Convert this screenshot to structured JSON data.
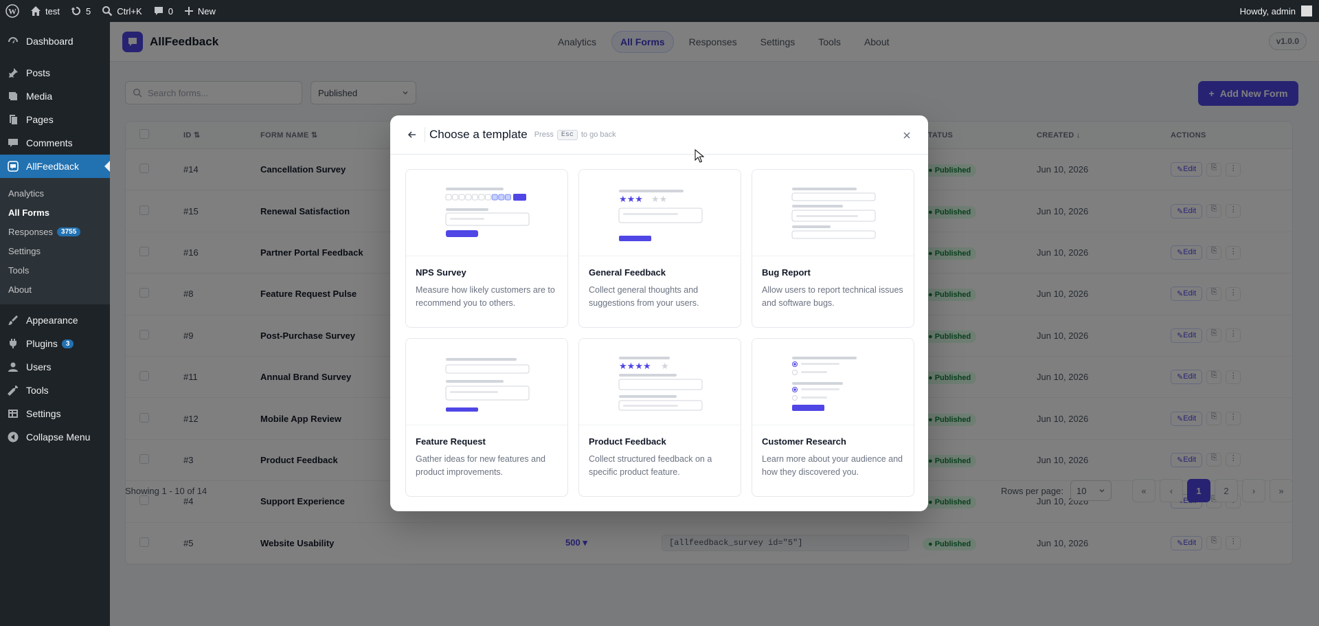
{
  "adminbar": {
    "site_name": "test",
    "updates_count": "5",
    "search_shortcut": "Ctrl+K",
    "comments_count": "0",
    "new_label": "New",
    "howdy": "Howdy, admin"
  },
  "sidebar": {
    "items_top": [
      {
        "label": "Dashboard",
        "icon": "dashboard-icon"
      },
      {
        "label": "Posts",
        "icon": "pin-icon"
      },
      {
        "label": "Media",
        "icon": "media-icon"
      },
      {
        "label": "Pages",
        "icon": "pages-icon"
      },
      {
        "label": "Comments",
        "icon": "comment-icon"
      },
      {
        "label": "AllFeedback",
        "icon": "feedback-icon"
      }
    ],
    "submenu": [
      {
        "label": "Analytics"
      },
      {
        "label": "All Forms"
      },
      {
        "label": "Responses",
        "badge": "3755"
      },
      {
        "label": "Settings"
      },
      {
        "label": "Tools"
      },
      {
        "label": "About"
      }
    ],
    "items_bottom": [
      {
        "label": "Appearance",
        "icon": "brush-icon"
      },
      {
        "label": "Plugins",
        "icon": "plugin-icon",
        "badge": "3"
      },
      {
        "label": "Users",
        "icon": "user-icon"
      },
      {
        "label": "Tools",
        "icon": "wrench-icon"
      },
      {
        "label": "Settings",
        "icon": "settings-icon"
      },
      {
        "label": "Collapse Menu",
        "icon": "collapse-icon"
      }
    ]
  },
  "app": {
    "brand": "AllFeedback",
    "nav": [
      "Analytics",
      "All Forms",
      "Responses",
      "Settings",
      "Tools",
      "About"
    ],
    "version": "v1.0.0",
    "search_placeholder": "Search forms...",
    "status_filter": "Published",
    "add_button": "Add New Form",
    "columns": [
      "ID",
      "FORM NAME",
      "STATUS",
      "CREATED",
      "ACTIONS"
    ],
    "rows": [
      {
        "id": "#14",
        "name": "Cancellation Survey",
        "status": "Published",
        "created": "Jun 10, 2026"
      },
      {
        "id": "#15",
        "name": "Renewal Satisfaction",
        "status": "Published",
        "created": "Jun 10, 2026"
      },
      {
        "id": "#16",
        "name": "Partner Portal Feedback",
        "status": "Published",
        "created": "Jun 10, 2026"
      },
      {
        "id": "#8",
        "name": "Feature Request Pulse",
        "status": "Published",
        "created": "Jun 10, 2026"
      },
      {
        "id": "#9",
        "name": "Post-Purchase Survey",
        "status": "Published",
        "created": "Jun 10, 2026"
      },
      {
        "id": "#11",
        "name": "Annual Brand Survey",
        "status": "Published",
        "created": "Jun 10, 2026"
      },
      {
        "id": "#12",
        "name": "Mobile App Review",
        "status": "Published",
        "created": "Jun 10, 2026"
      },
      {
        "id": "#3",
        "name": "Product Feedback",
        "status": "Published",
        "created": "Jun 10, 2026"
      },
      {
        "id": "#4",
        "name": "Support Experience",
        "status": "Published",
        "created": "Jun 10, 2026"
      },
      {
        "id": "#5",
        "name": "Website Usability",
        "status": "Published",
        "created": "Jun 10, 2026",
        "responses": "500",
        "shortcode": "[allfeedback_survey id=\"5\"]"
      }
    ],
    "edit_label": "Edit",
    "showing": "Showing 1 - 10 of 14",
    "rows_per_page_label": "Rows per page:",
    "rows_per_page": "10",
    "pages": [
      "1",
      "2"
    ]
  },
  "modal": {
    "title": "Choose a template",
    "hint_press": "Press",
    "hint_key": "Esc",
    "hint_rest": "to go back",
    "templates": [
      {
        "title": "NPS Survey",
        "description": "Measure how likely customers are to recommend you to others."
      },
      {
        "title": "General Feedback",
        "description": "Collect general thoughts and suggestions from your users."
      },
      {
        "title": "Bug Report",
        "description": "Allow users to report technical issues and software bugs."
      },
      {
        "title": "Feature Request",
        "description": "Gather ideas for new features and product improvements."
      },
      {
        "title": "Product Feedback",
        "description": "Collect structured feedback on a specific product feature."
      },
      {
        "title": "Customer Research",
        "description": "Learn more about your audience and how they discovered you."
      }
    ]
  },
  "colors": {
    "accent": "#4f46e5",
    "wp_blue": "#2271b1",
    "adminbar": "#1d2327"
  }
}
